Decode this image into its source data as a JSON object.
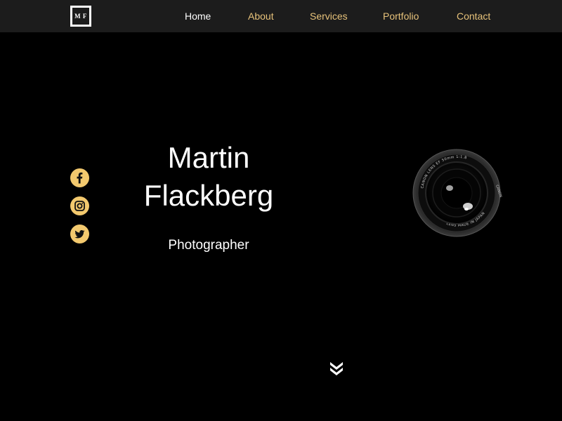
{
  "nav": {
    "logo_text": "M F",
    "items": [
      {
        "label": "Home",
        "active": true
      },
      {
        "label": "About",
        "active": false
      },
      {
        "label": "Services",
        "active": false
      },
      {
        "label": "Portfolio",
        "active": false
      },
      {
        "label": "Contact",
        "active": false
      }
    ]
  },
  "social": [
    {
      "icon": "facebook-icon"
    },
    {
      "icon": "instagram-icon"
    },
    {
      "icon": "twitter-icon"
    }
  ],
  "hero": {
    "first_name": "Martin",
    "last_name": "Flackberg",
    "role": "Photographer"
  },
  "lens_image": {
    "icon": "camera-lens-image",
    "ring_text_top": "CANON LENS EF 50mm 1:1.8",
    "ring_text_right": "CANON",
    "ring_text_bottom": "LENS MADE IN JAPAN"
  },
  "scroll": {
    "icon": "chevron-double-down-icon"
  },
  "colors": {
    "background": "#000000",
    "navbar": "#1c1c1c",
    "accent": "#e7c27a",
    "social_icon_bg": "#f3c96e",
    "text": "#ffffff"
  }
}
